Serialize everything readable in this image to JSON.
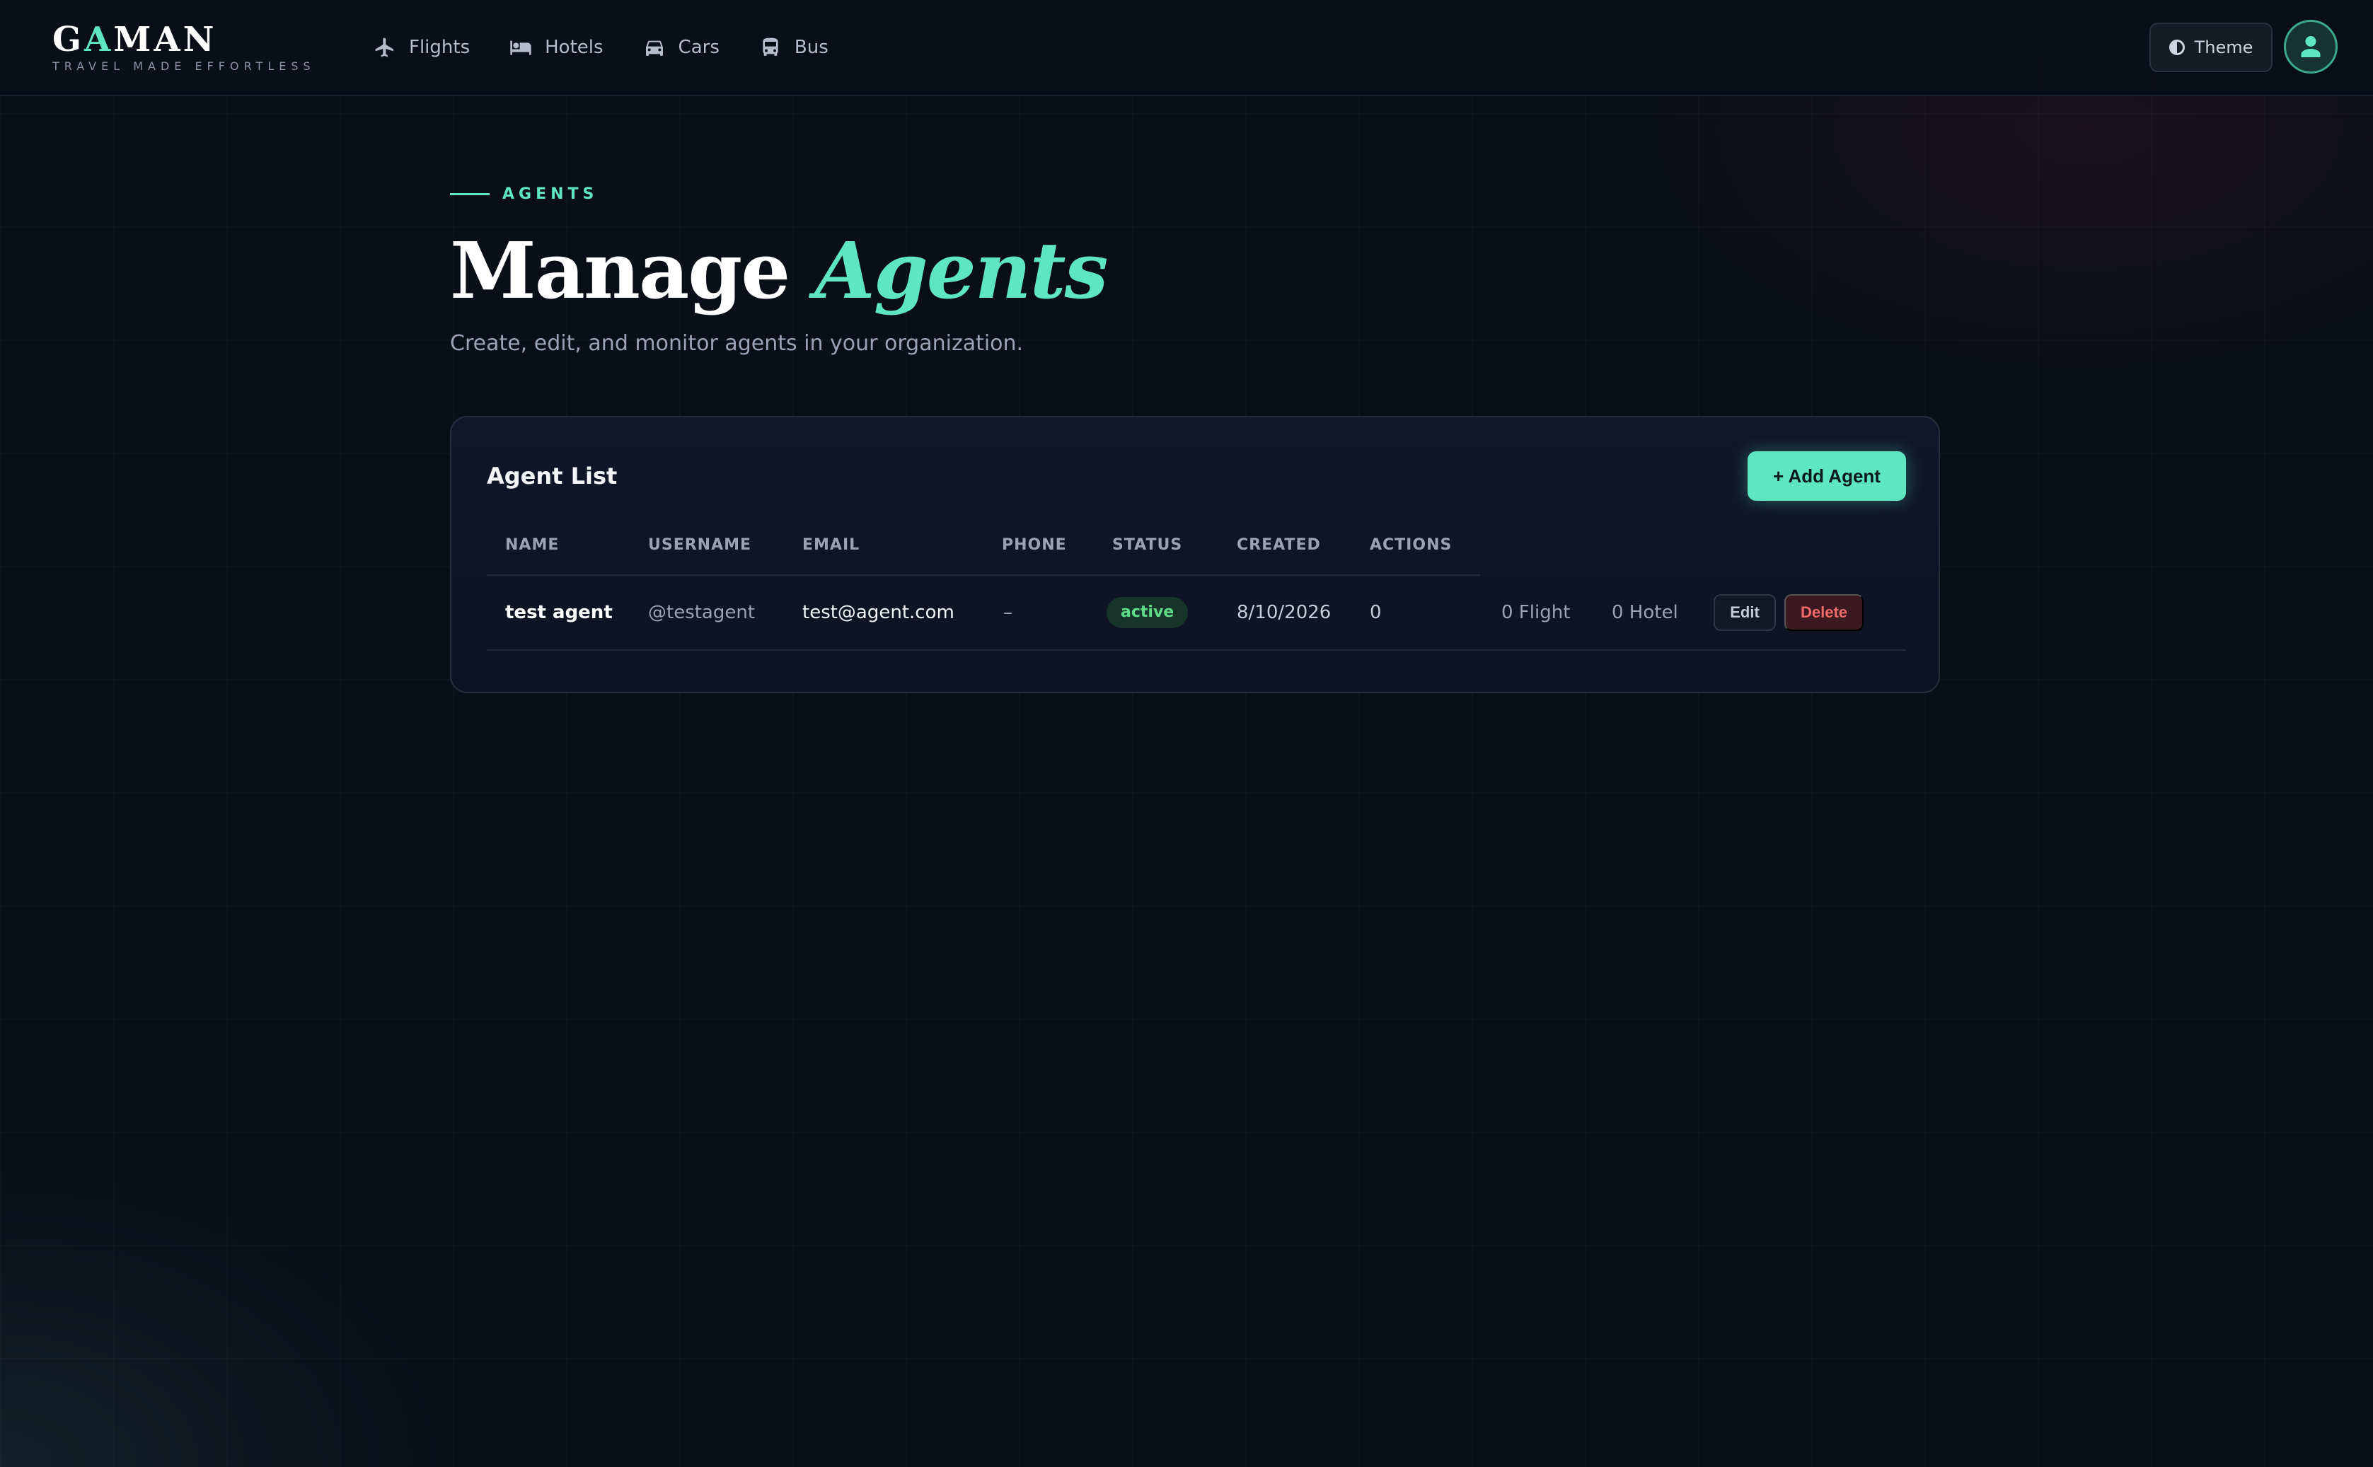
{
  "brand": {
    "logo_prefix": "G",
    "logo_accent": "A",
    "logo_suffix": "MAN",
    "tagline": "TRAVEL MADE EFFORTLESS"
  },
  "nav": {
    "items": [
      {
        "label": "Flights",
        "icon": "airplane-icon"
      },
      {
        "label": "Hotels",
        "icon": "bed-icon"
      },
      {
        "label": "Cars",
        "icon": "car-icon"
      },
      {
        "label": "Bus",
        "icon": "bus-icon"
      }
    ],
    "theme_label": "Theme"
  },
  "header": {
    "eyebrow": "AGENTS",
    "title_plain": "Manage ",
    "title_accent": "Agents",
    "subtitle": "Create, edit, and monitor agents in your organization."
  },
  "agent_list": {
    "title": "Agent List",
    "add_label": "+ Add Agent",
    "columns": [
      "NAME",
      "USERNAME",
      "EMAIL",
      "PHONE",
      "STATUS",
      "CREATED",
      "ACTIONS"
    ],
    "rows": [
      {
        "name": "test agent",
        "username": "@testagent",
        "email": "test@agent.com",
        "phone": "–",
        "status": "active",
        "created": "8/10/2026",
        "actions": "0",
        "flight": "0 Flight",
        "hotel": "0 Hotel",
        "edit_label": "Edit",
        "delete_label": "Delete"
      }
    ]
  },
  "colors": {
    "accent": "#5ee6c0",
    "background": "#0a0e19",
    "danger": "#f06b6b",
    "success": "#5fdc8a"
  }
}
